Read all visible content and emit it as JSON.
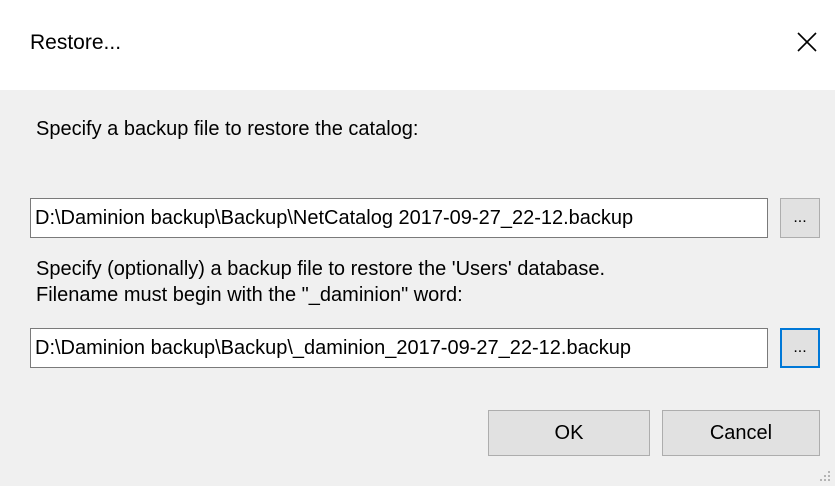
{
  "window": {
    "title": "Restore...",
    "close_icon": "close-icon"
  },
  "catalog": {
    "label": "Specify a backup file to restore the catalog:",
    "path_value": "D:\\Daminion backup\\Backup\\NetCatalog 2017-09-27_22-12.backup",
    "browse_label": "..."
  },
  "users": {
    "label_line1": "Specify (optionally) a backup file to restore the 'Users' database.",
    "label_line2": "Filename must begin with the \"_daminion\" word:",
    "path_value": "D:\\Daminion backup\\Backup\\_daminion_2017-09-27_22-12.backup",
    "browse_label": "..."
  },
  "buttons": {
    "ok_label": "OK",
    "cancel_label": "Cancel"
  },
  "colors": {
    "focus_accent": "#0078d7",
    "client_background": "#f0f0f0",
    "button_face": "#e1e1e1"
  }
}
